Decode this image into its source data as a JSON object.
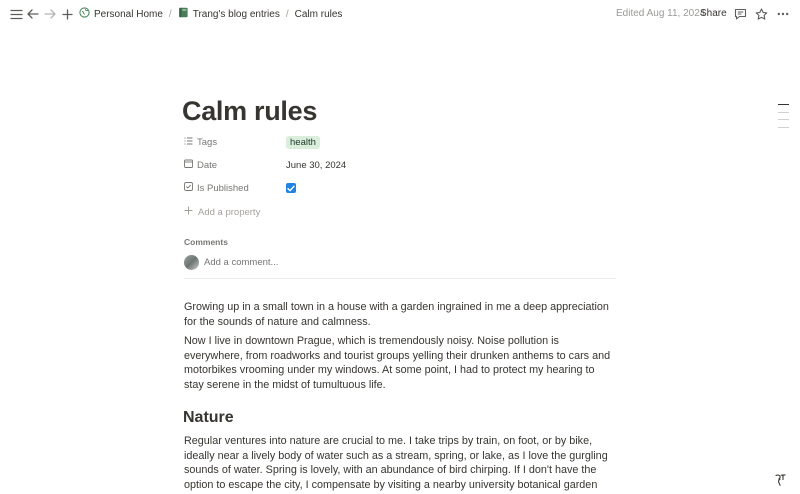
{
  "topbar": {
    "breadcrumbs": [
      "Personal Home",
      "Trang's blog entries",
      "Calm rules"
    ],
    "separator": "/",
    "edited": "Edited Aug 11, 2024",
    "share_label": "Share"
  },
  "page": {
    "title": "Calm rules",
    "properties": [
      {
        "name": "Tags",
        "value": "health",
        "icon": "list-icon"
      },
      {
        "name": "Date",
        "value": "June 30, 2024",
        "icon": "calendar-icon"
      },
      {
        "name": "Is Published",
        "checked": true,
        "icon": "checkbox-icon"
      }
    ],
    "add_property_label": "Add a property",
    "comments_label": "Comments",
    "comment_placeholder": "Add a comment..."
  },
  "content": {
    "paragraphs": [
      "Growing up in a small town in a house with a garden ingrained in me a deep appreciation for the sounds of nature and calmness.",
      "Now I live in downtown Prague, which is tremendously noisy. Noise pollution is everywhere, from roadworks and tourist groups yelling their drunken anthems to cars and motorbikes vrooming under my windows. At some point, I had to protect my hearing to stay serene in the midst of tumultuous life."
    ],
    "heading": "Nature",
    "nature_paragraph": "Regular ventures into nature are crucial to me. I take trips by train, on foot, or by bike, ideally near a lively body of water such as a stream, spring, or lake, as I love the gurgling sounds of water. Spring is lovely, with an abundance of bird chirping. If I don't have the option to escape the city, I compensate by visiting a nearby university botanical garden (which offers free entrance to all"
  },
  "colors": {
    "tag_bg": "#dbeddb",
    "checkbox": "#2383e2",
    "text": "#37352f",
    "muted": "#787774"
  }
}
